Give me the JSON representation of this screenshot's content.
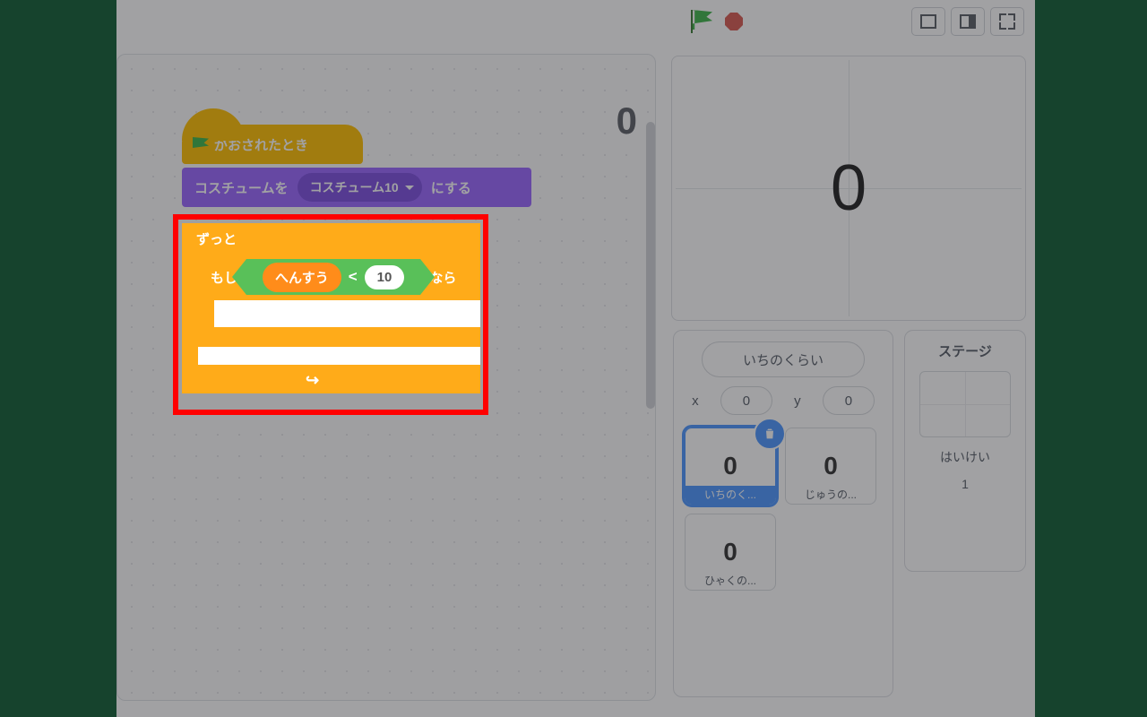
{
  "readout": "0",
  "hat_label": "がおされたとき",
  "looks": {
    "pre": "コスチュームを",
    "costume": "コスチューム10",
    "post": "にする"
  },
  "forever_label": "ずっと",
  "if": {
    "pre": "もし",
    "var": "へんすう",
    "op": "<",
    "num": "10",
    "post": "なら"
  },
  "stage_num": "0",
  "sprite": {
    "name": "いちのくらい",
    "x_label": "x",
    "x": "0",
    "y_label": "y",
    "y": "0",
    "thumbs": [
      {
        "num": "0",
        "label": "いちのく...",
        "selected": true
      },
      {
        "num": "0",
        "label": "じゅうの...",
        "selected": false
      },
      {
        "num": "0",
        "label": "ひゃくの...",
        "selected": false
      }
    ]
  },
  "stagepanel": {
    "title": "ステージ",
    "backdrop_label": "はいけい",
    "backdrop_count": "1"
  }
}
